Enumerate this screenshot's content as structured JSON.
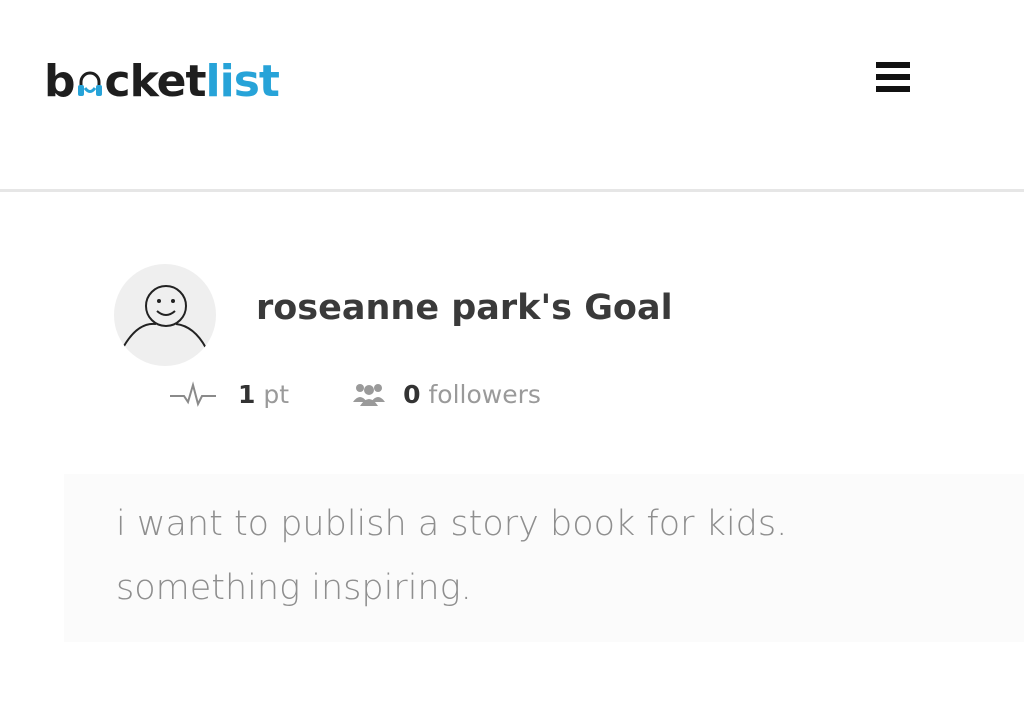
{
  "header": {
    "logo": {
      "part_a": "b",
      "part_u": "u",
      "part_b": "cket",
      "part_c": "list"
    },
    "menu_icon": "hamburger-menu-icon"
  },
  "goal": {
    "avatar_icon": "smiley-avatar-icon",
    "title": "roseanne park's Goal",
    "points_icon": "pulse-icon",
    "points_value": "1",
    "points_unit": "pt",
    "followers_icon": "people-icon",
    "followers_value": "0",
    "followers_label": "followers",
    "description": "i want to publish a story book for kids.\nsomething inspiring."
  },
  "colors": {
    "brand_blue": "#27a3d8",
    "logo_dark": "#1e1e1e",
    "title_text": "#3a3a3a",
    "muted_text": "#8e8e8e"
  }
}
